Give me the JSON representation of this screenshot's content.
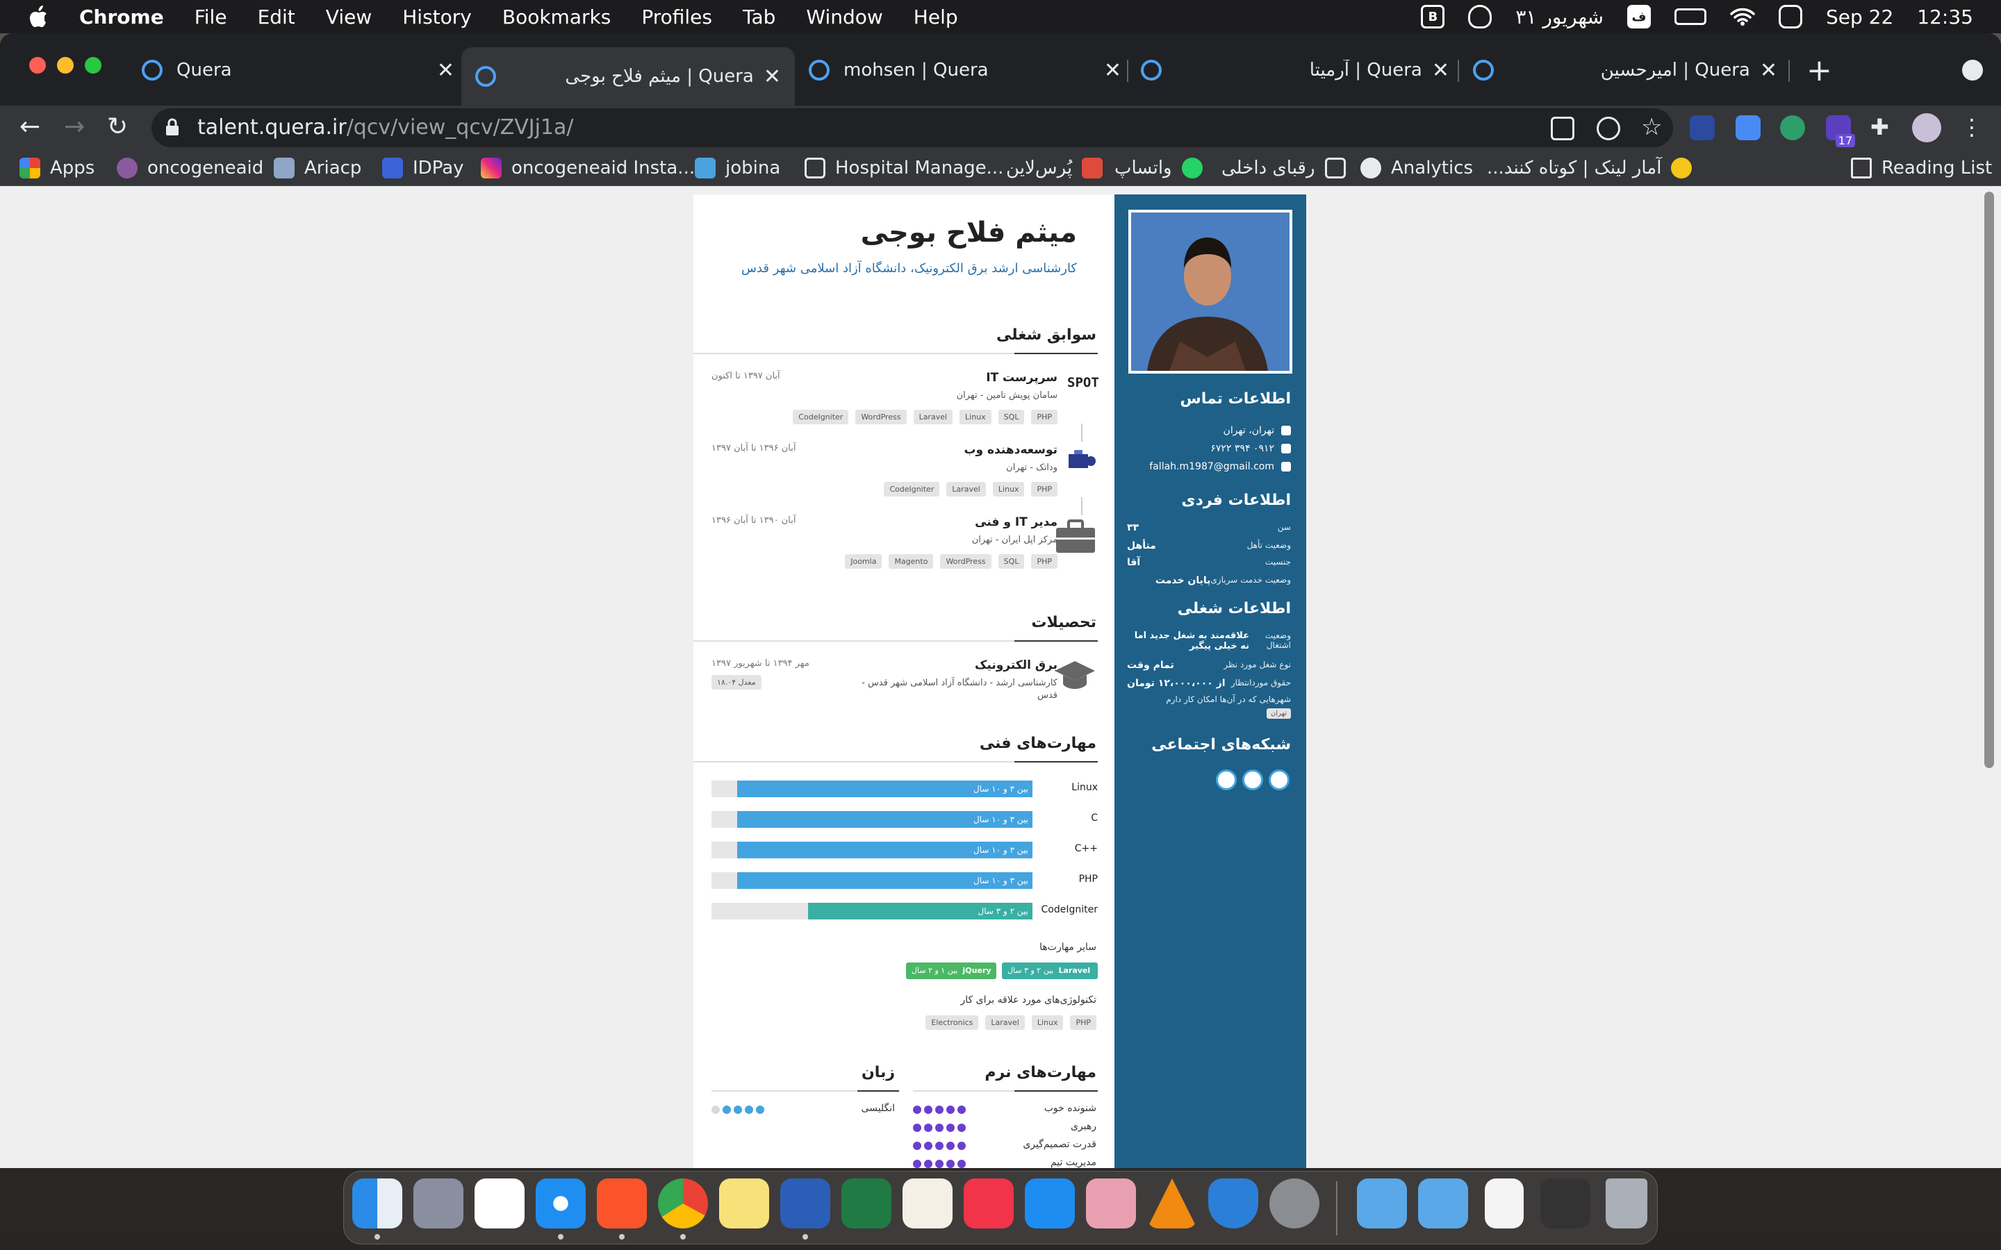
{
  "menubar": {
    "app": "Chrome",
    "items": [
      "File",
      "Edit",
      "View",
      "History",
      "Bookmarks",
      "Profiles",
      "Tab",
      "Window",
      "Help"
    ],
    "persian_date": "۳۱ شهریور",
    "keyboard": "ف",
    "date": "Sep 22",
    "time": "12:35"
  },
  "tabs": [
    {
      "title": "Quera"
    },
    {
      "title": "Quera | میثم فلاح بوجی"
    },
    {
      "title": "mohsen | Quera"
    },
    {
      "title": "Quera | آرمیتا"
    },
    {
      "title": "Quera | امیرحسین"
    }
  ],
  "omnibox": {
    "host": "talent.quera.ir",
    "path": "/qcv/view_qcv/ZVJj1a/"
  },
  "extensions": {
    "badge": "17"
  },
  "bookmarks": {
    "items": [
      "Apps",
      "oncogeneaid",
      "Ariacp",
      "IDPay",
      "oncogeneaid Insta...",
      "jobina",
      "Hospital Manage...",
      "پُرس‌لاین",
      "واتساپ",
      "رقبای داخلی",
      "Analytics",
      "آمار لینک | کوتاه کنند..."
    ],
    "reading_list": "Reading List"
  },
  "resume": {
    "name": "میثم فلاح بوجی",
    "subtitle": "کارشناسی ارشد برق الکترونیک، دانشگاه آزاد اسلامی شهر قدس",
    "sections": {
      "experience": "سوابق شغلی",
      "education": "تحصیلات",
      "skills": "مهارت‌های فنی",
      "soft_skills": "مهارت‌های نرم",
      "languages": "زبان"
    },
    "jobs": [
      {
        "title": "سرپرست IT",
        "company": "سامان پویش تامین - تهران",
        "date": "آبان ۱۳۹۷ تا اکنون",
        "tags": [
          "PHP",
          "SQL",
          "Linux",
          "Laravel",
          "WordPress",
          "CodeIgniter"
        ],
        "logo": "SPOT"
      },
      {
        "title": "توسعه‌دهنده وب",
        "company": "وداتک - تهران",
        "date": "آبان ۱۳۹۶ تا آبان ۱۳۹۷",
        "tags": [
          "PHP",
          "Linux",
          "Laravel",
          "CodeIgniter"
        ]
      },
      {
        "title": "مدیر IT و فنی",
        "company": "مرکز اپل ایران - تهران",
        "date": "آبان ۱۳۹۰ تا آبان ۱۳۹۶",
        "tags": [
          "PHP",
          "SQL",
          "WordPress",
          "Magento",
          "Joomla"
        ]
      }
    ],
    "education": {
      "title": "برق الکترونیک",
      "detail1": "کارشناسی ارشد - دانشگاه آزاد اسلامی شهر قدس -",
      "detail2": "قدس",
      "date": "مهر ۱۳۹۴ تا شهریور ۱۳۹۷",
      "gpa": "معدل ۱۸.۰۴"
    },
    "skills": [
      {
        "name": "Linux",
        "level": "بین ۳ و ۱۰ سال",
        "fraction": 0.92
      },
      {
        "name": "C",
        "level": "بین ۳ و ۱۰ سال",
        "fraction": 0.92
      },
      {
        "name": "C++",
        "level": "بین ۳ و ۱۰ سال",
        "fraction": 0.92
      },
      {
        "name": "PHP",
        "level": "بین ۳ و ۱۰ سال",
        "fraction": 0.92
      },
      {
        "name": "CodeIgniter",
        "level": "بین ۲ و ۳ سال",
        "fraction": 0.7
      }
    ],
    "other_skills_title": "سایر مهارت‌ها",
    "other_skills": [
      {
        "name": "Laravel",
        "level": "بین ۲ و ۳ سال"
      },
      {
        "name": "jQuery",
        "level": "بین ۱ و ۲ سال"
      }
    ],
    "interests_title": "تکنولوژی‌های مورد علاقه برای کار",
    "interests": [
      "PHP",
      "Linux",
      "Laravel",
      "Electronics"
    ],
    "soft_skills": [
      {
        "name": "شنونده خوب",
        "rating": 5
      },
      {
        "name": "رهبری",
        "rating": 5
      },
      {
        "name": "قدرت تصمیم‌گیری",
        "rating": 5
      },
      {
        "name": "مدیریت تیم",
        "rating": 5
      }
    ],
    "languages": [
      {
        "name": "انگلیسی",
        "rating": 4
      }
    ],
    "sidebar": {
      "contact_title": "اطلاعات تماس",
      "location": "تهران، تهران",
      "phone": "۰۹۱۲ ۳۹۴ ۶۷۲۲",
      "email": "fallah.m1987@gmail.com",
      "personal_title": "اطلاعات فردی",
      "age_k": "سن",
      "age_v": "۳۳",
      "marital_k": "وضعیت تأهل",
      "marital_v": "متأهل",
      "gender_k": "جنسیت",
      "gender_v": "آقا",
      "military_k": "وضعیت خدمت سربازی",
      "military_v": "پایان خدمت",
      "job_title": "اطلاعات شغلی",
      "status_k": "وضعیت اشتغال",
      "status_v": "علاقه‌مند به شغل جدید اما نه خیلی پیگیر",
      "type_k": "نوع شغل مورد نظر",
      "type_v": "تمام وقت",
      "salary_k": "حقوق مورد‌انتظار",
      "salary_v": "از ۱۲،۰۰۰،۰۰۰ تومان",
      "cities_k": "شهرهایی که در آن‌ها امکان کار دارم",
      "city": "تهران",
      "social_title": "شبکه‌های اجتماعی"
    }
  },
  "colors": {
    "sidebar": "#1e6088",
    "skill_bar": "#43a4e0",
    "skill_bar_alt": "#3aafa3",
    "soft_dot": "#6a3fd0"
  }
}
